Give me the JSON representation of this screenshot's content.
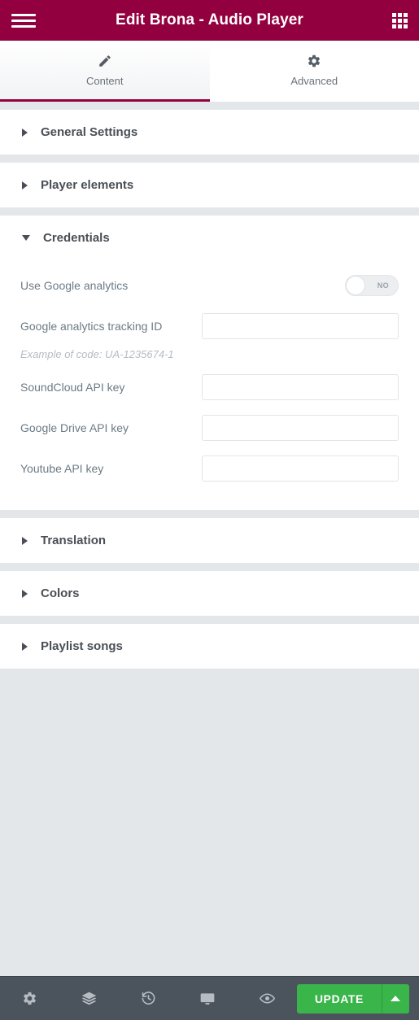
{
  "header": {
    "title": "Edit Brona - Audio Player",
    "menu_icon": "hamburger-menu-icon",
    "apps_icon": "grid-apps-icon",
    "background_color": "#93003f"
  },
  "tabs": [
    {
      "label": "Content",
      "icon": "pencil-icon",
      "active": true
    },
    {
      "label": "Advanced",
      "icon": "gear-icon",
      "active": false
    }
  ],
  "sections": [
    {
      "title": "General Settings",
      "expanded": false
    },
    {
      "title": "Player elements",
      "expanded": false
    },
    {
      "title": "Credentials",
      "expanded": true
    },
    {
      "title": "Translation",
      "expanded": false
    },
    {
      "title": "Colors",
      "expanded": false
    },
    {
      "title": "Playlist songs",
      "expanded": false
    }
  ],
  "credentials": {
    "use_google_analytics": {
      "label": "Use Google analytics",
      "toggle_state": "NO"
    },
    "tracking_id": {
      "label": "Google analytics tracking ID",
      "value": "",
      "placeholder": "",
      "hint": "Example of code: UA-1235674-1"
    },
    "soundcloud_api_key": {
      "label": "SoundCloud API key",
      "value": "",
      "placeholder": ""
    },
    "google_drive_api_key": {
      "label": "Google Drive API key",
      "value": "",
      "placeholder": ""
    },
    "youtube_api_key": {
      "label": "Youtube API key",
      "value": "",
      "placeholder": ""
    }
  },
  "bottombar": {
    "icons": [
      {
        "name": "settings-gear-icon"
      },
      {
        "name": "navigator-layers-icon"
      },
      {
        "name": "history-revisions-icon"
      },
      {
        "name": "responsive-monitor-icon"
      },
      {
        "name": "preview-eye-icon"
      }
    ],
    "update_label": "UPDATE",
    "update_color": "#39b54a",
    "caret_icon": "chevron-up-icon"
  }
}
